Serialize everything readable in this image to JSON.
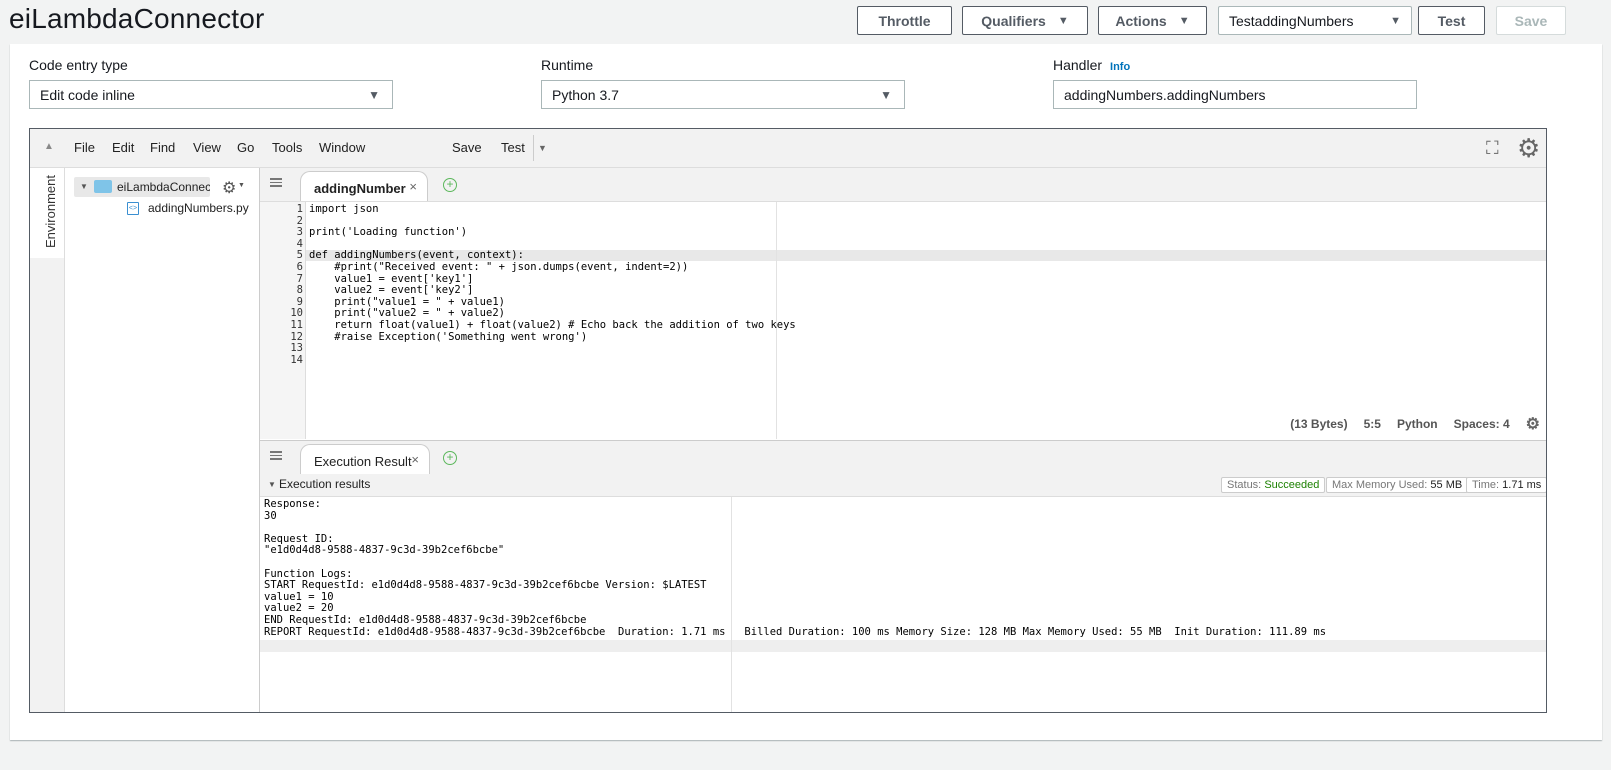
{
  "app": {
    "title": "eiLambdaConnector"
  },
  "toolbar": {
    "throttle_label": "Throttle",
    "qualifiers_label": "Qualifiers",
    "actions_label": "Actions",
    "test_event_selected": "TestaddingNumbers",
    "test_label": "Test",
    "save_label": "Save"
  },
  "config": {
    "code_entry_type_label": "Code entry type",
    "code_entry_type_value": "Edit code inline",
    "runtime_label": "Runtime",
    "runtime_value": "Python 3.7",
    "handler_label": "Handler",
    "handler_info": "Info",
    "handler_value": "addingNumbers.addingNumbers"
  },
  "ide": {
    "menu": [
      "File",
      "Edit",
      "Find",
      "View",
      "Go",
      "Tools",
      "Window",
      "Save",
      "Test"
    ],
    "environment_label": "Environment",
    "tree": {
      "root": "eiLambdaConnector",
      "file": "addingNumbers.py"
    },
    "editor_tab": "addingNumbers.py",
    "code_lines": [
      "import json",
      "",
      "print('Loading function')",
      "",
      "def addingNumbers(event, context):",
      "    #print(\"Received event: \" + json.dumps(event, indent=2))",
      "    value1 = event['key1']",
      "    value2 = event['key2']",
      "    print(\"value1 = \" + value1)",
      "    print(\"value2 = \" + value2)",
      "    return float(value1) + float(value2) # Echo back the addition of two keys",
      "    #raise Exception('Something went wrong')",
      "",
      ""
    ],
    "status": {
      "bytes": "(13 Bytes)",
      "cursor": "5:5",
      "language": "Python",
      "spaces": "Spaces: 4"
    },
    "output_tab": "Execution Result",
    "exec_results_label": "Execution results",
    "badges": {
      "status_label": "Status:",
      "status_value": "Succeeded",
      "memory_label": "Max Memory Used:",
      "memory_value": "55 MB",
      "time_label": "Time:",
      "time_value": "1.71 ms"
    },
    "output_lines": [
      "Response:",
      "30",
      "",
      "Request ID:",
      "\"e1d0d4d8-9588-4837-9c3d-39b2cef6bcbe\"",
      "",
      "Function Logs:",
      "START RequestId: e1d0d4d8-9588-4837-9c3d-39b2cef6bcbe Version: $LATEST",
      "value1 = 10",
      "value2 = 20",
      "END RequestId: e1d0d4d8-9588-4837-9c3d-39b2cef6bcbe",
      "REPORT RequestId: e1d0d4d8-9588-4837-9c3d-39b2cef6bcbe  Duration: 1.71 ms   Billed Duration: 100 ms Memory Size: 128 MB Max Memory Used: 55 MB  Init Duration: 111.89 ms"
    ]
  }
}
